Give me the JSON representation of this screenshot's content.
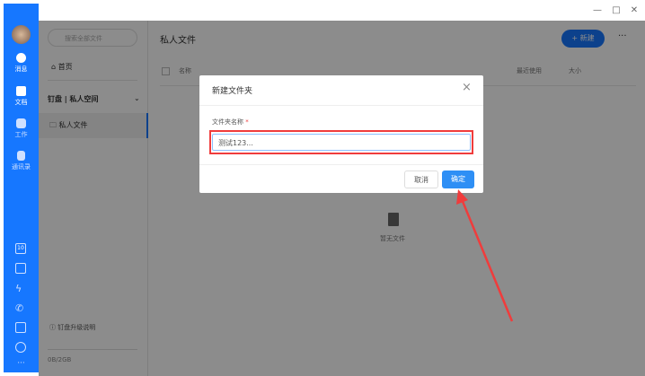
{
  "window": {
    "minimize": "—",
    "maximize": "□",
    "close": "✕"
  },
  "nav": {
    "items": [
      {
        "label": "消息",
        "icon": "chat-icon"
      },
      {
        "label": "文档",
        "icon": "doc-icon"
      },
      {
        "label": "工作",
        "icon": "apps-icon"
      },
      {
        "label": "通讯录",
        "icon": "contacts-icon"
      }
    ],
    "calendar_day": "10",
    "more": "···"
  },
  "left_panel": {
    "search_placeholder": "搜索全部文件",
    "home": "首页",
    "space_title": "钉盘",
    "space_name": "私人空间",
    "folder": "私人文件",
    "upgrade": "钉盘升级说明",
    "storage": "0B/2GB"
  },
  "main": {
    "title": "私人文件",
    "new_button": "新建",
    "more": "···",
    "columns": {
      "name": "名称",
      "recent": "最近使用",
      "size": "大小"
    },
    "empty": "暂无文件"
  },
  "dialog": {
    "title": "新建文件夹",
    "close": "×",
    "field_label": "文件夹名称",
    "required": "*",
    "field_value": "测试123...",
    "cancel": "取消",
    "ok": "确定"
  },
  "colors": {
    "brand": "#1677ff",
    "annotation": "#f03c3c"
  }
}
